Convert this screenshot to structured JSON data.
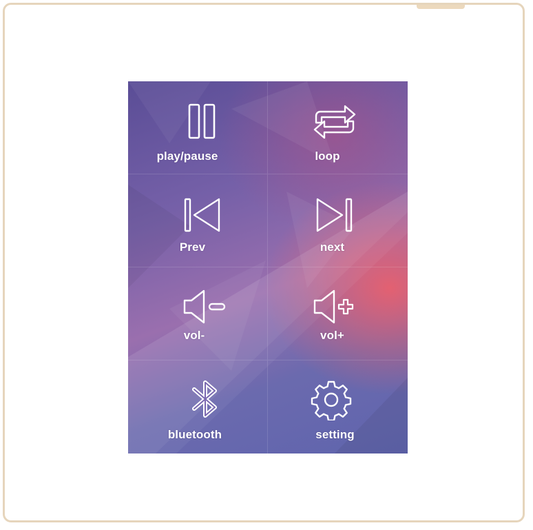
{
  "controls": [
    {
      "label": "play/pause",
      "icon": "pause-icon"
    },
    {
      "label": "loop",
      "icon": "loop-icon"
    },
    {
      "label": "Prev",
      "icon": "previous-icon"
    },
    {
      "label": "next",
      "icon": "next-icon"
    },
    {
      "label": "vol-",
      "icon": "volume-down-icon"
    },
    {
      "label": "vol+",
      "icon": "volume-up-icon"
    },
    {
      "label": "bluetooth",
      "icon": "bluetooth-icon"
    },
    {
      "label": "setting",
      "icon": "gear-icon"
    }
  ],
  "colors": {
    "frame_border": "#e6d5bc",
    "panel_purple": "#6b5aa6",
    "panel_pink": "#e8606e",
    "icon_stroke": "#ffffff"
  }
}
